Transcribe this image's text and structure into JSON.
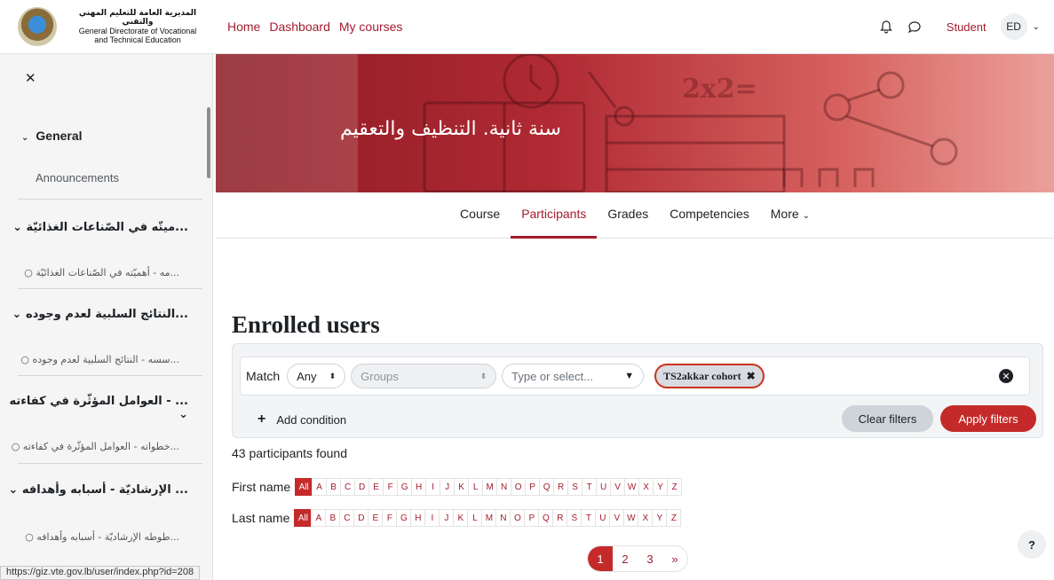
{
  "logo": {
    "line_ar": "المديرية العامة للتعليم المهني والتقني",
    "line1": "General Directorate of Vocational",
    "line2": "and Technical Education"
  },
  "nav": {
    "links": [
      "Home",
      "Dashboard",
      "My courses"
    ],
    "user_name": "Student",
    "avatar_initials": "ED"
  },
  "drawer": {
    "close": "✕",
    "general": "General",
    "announcements": "Announcements",
    "sections": [
      {
        "title": "...ميتّه في الصّناعات الغذائيّة",
        "sub": "...مه - أهميّته في الصّناعات الغذائيّة"
      },
      {
        "title": "...النتائج السلبية لعدم وجوده",
        "sub": "...سسه - النتائج السلبية لعدم وجوده"
      },
      {
        "title": "... - العوامل المؤثّرة في كفاءته",
        "sub": "...خطواته - العوامل المؤثّرة في كفاءته"
      },
      {
        "title": "... الإرشاديّة - أسبابه وأهدافه",
        "sub": "...طوطه الإرشاديّة - أسبابه وأهدافه"
      }
    ]
  },
  "hero": {
    "title": "سنة ثانية. التنظيف والتعقيم",
    "formula": "2x2="
  },
  "tabs": [
    "Course",
    "Participants",
    "Grades",
    "Competencies",
    "More"
  ],
  "active_tab": "Participants",
  "page_title": "Enrolled users",
  "filter": {
    "match_label": "Match",
    "match_value": "Any",
    "groups_value": "Groups",
    "autocomplete_placeholder": "Type or select...",
    "cohort_badge": "TS2akkar cohort",
    "add_condition": "Add condition",
    "clear_filters": "Clear filters",
    "apply_filters": "Apply filters"
  },
  "participants_found": "43 participants found",
  "initials": {
    "first_name_label": "First name",
    "last_name_label": "Last name",
    "all": "All",
    "letters": [
      "A",
      "B",
      "C",
      "D",
      "E",
      "F",
      "G",
      "H",
      "I",
      "J",
      "K",
      "L",
      "M",
      "N",
      "O",
      "P",
      "Q",
      "R",
      "S",
      "T",
      "U",
      "V",
      "W",
      "X",
      "Y",
      "Z"
    ]
  },
  "pagination": {
    "pages": [
      "1",
      "2",
      "3"
    ],
    "next": "»",
    "current": "1"
  },
  "help": "?",
  "status_url": "https://giz.vte.gov.lb/user/index.php?id=208",
  "colors": {
    "brand": "#a31d2d",
    "primary_button": "#c42a2a",
    "hero_start": "#8b1a23",
    "hero_end": "#eba09a"
  }
}
